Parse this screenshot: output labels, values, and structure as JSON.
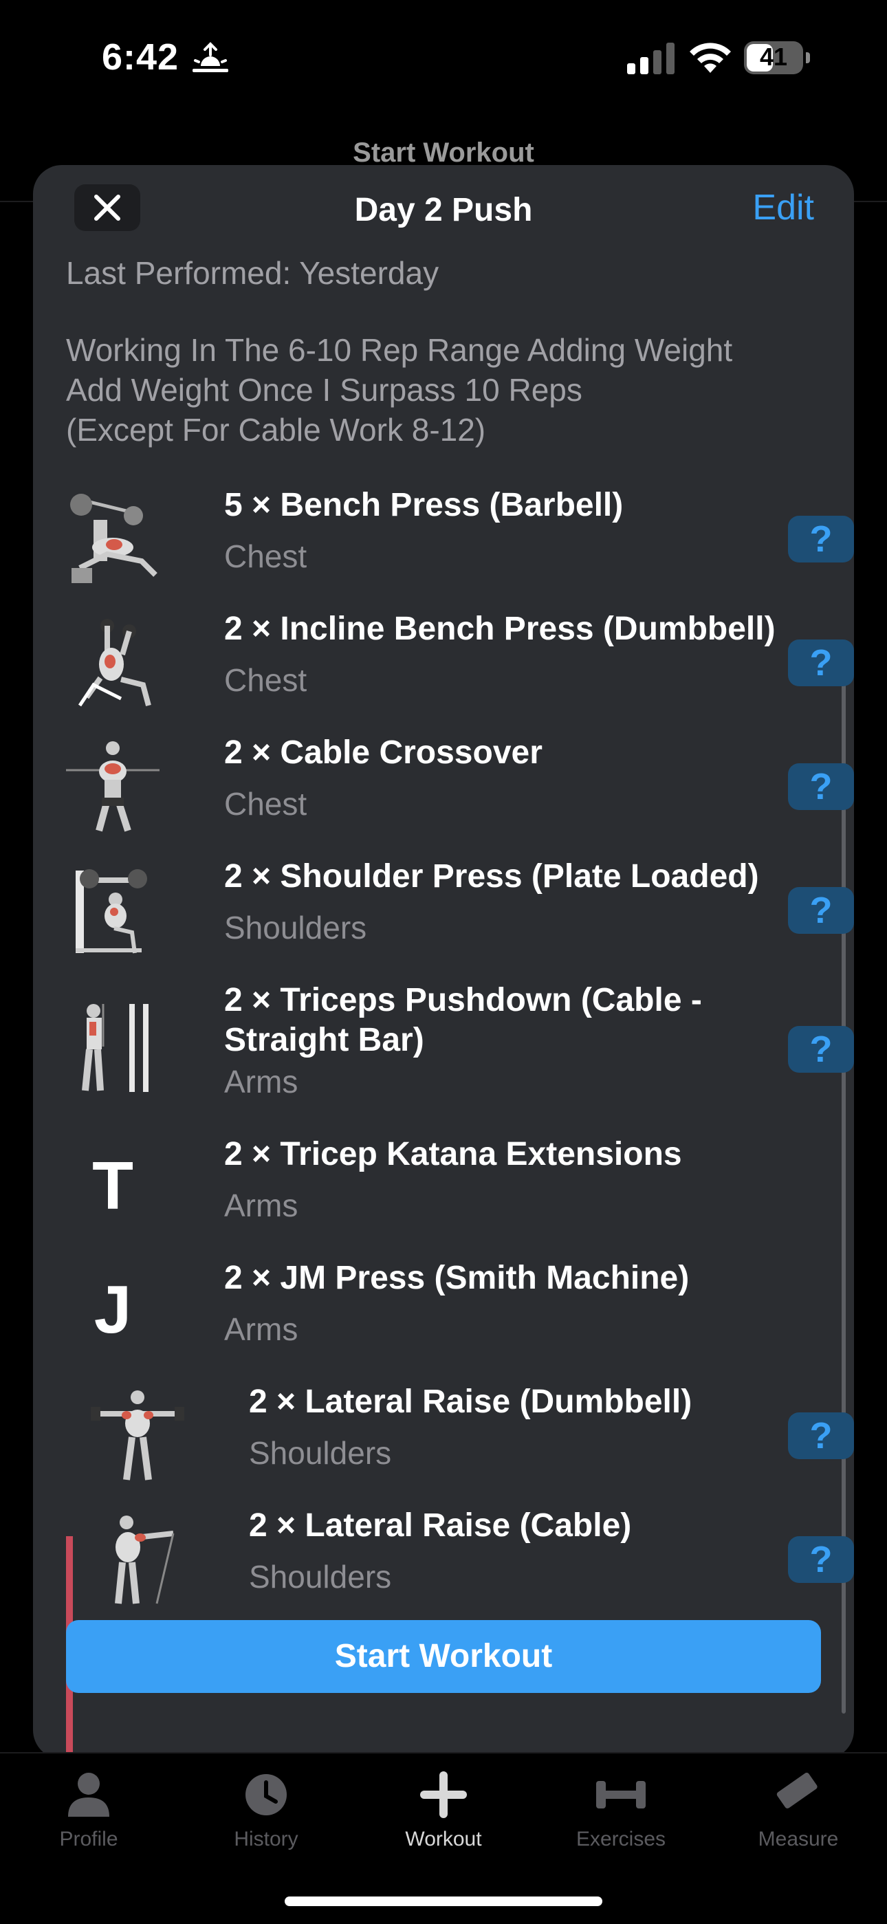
{
  "status_bar": {
    "time": "6:42",
    "battery": "41"
  },
  "background": {
    "title": "Start Workout"
  },
  "sheet": {
    "title": "Day 2 Push",
    "edit_label": "Edit",
    "last_performed": "Last Performed: Yesterday",
    "notes": [
      "Working In The 6-10 Rep Range Adding Weight",
      "Add Weight Once I Surpass 10 Reps",
      "(Except For Cable Work 8-12)"
    ],
    "exercises": [
      {
        "name": "5 × Bench Press (Barbell)",
        "category": "Chest",
        "help": "?"
      },
      {
        "name": "2 × Incline Bench Press (Dumbbell)",
        "category": "Chest",
        "help": "?"
      },
      {
        "name": "2 × Cable Crossover",
        "category": "Chest",
        "help": "?"
      },
      {
        "name": "2 × Shoulder Press (Plate Loaded)",
        "category": "Shoulders",
        "help": "?"
      },
      {
        "name": "2 × Triceps Pushdown (Cable - Straight Bar)",
        "category": "Arms",
        "help": "?"
      },
      {
        "name": "2 × Tricep Katana Extensions",
        "category": "Arms",
        "letter": "T"
      },
      {
        "name": "2 × JM Press (Smith Machine)",
        "category": "Arms",
        "letter": "J"
      },
      {
        "name": "2 × Lateral Raise (Dumbbell)",
        "category": "Shoulders",
        "help": "?"
      },
      {
        "name": "2 × Lateral Raise (Cable)",
        "category": "Shoulders",
        "help": "?"
      }
    ],
    "start_label": "Start Workout"
  },
  "tabs": [
    {
      "label": "Profile",
      "icon": "person-icon"
    },
    {
      "label": "History",
      "icon": "clock-icon"
    },
    {
      "label": "Workout",
      "icon": "plus-icon",
      "active": true
    },
    {
      "label": "Exercises",
      "icon": "dumbbell-icon"
    },
    {
      "label": "Measure",
      "icon": "ruler-icon"
    }
  ],
  "colors": {
    "accent": "#3aa0f5",
    "sheet": "#2b2d31",
    "superset": "#c94a5a"
  }
}
